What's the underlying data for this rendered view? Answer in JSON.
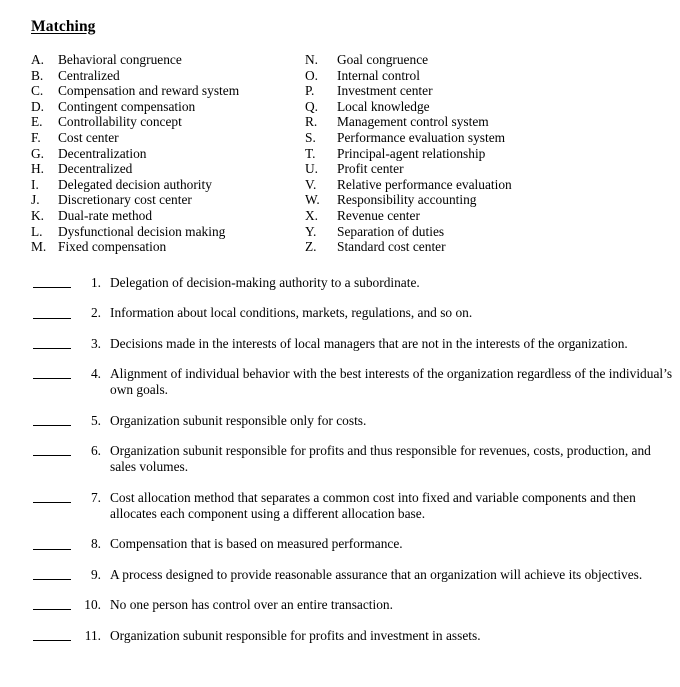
{
  "document": {
    "title": "Matching"
  },
  "terms": {
    "left_column": [
      {
        "key": "A.",
        "label": "Behavioral congruence"
      },
      {
        "key": "B.",
        "label": "Centralized"
      },
      {
        "key": "C.",
        "label": "Compensation and reward system"
      },
      {
        "key": "D.",
        "label": "Contingent compensation"
      },
      {
        "key": "E.",
        "label": "Controllability concept"
      },
      {
        "key": "F.",
        "label": "Cost center"
      },
      {
        "key": "G.",
        "label": "Decentralization"
      },
      {
        "key": "H.",
        "label": "Decentralized"
      },
      {
        "key": "I.",
        "label": "Delegated decision authority"
      },
      {
        "key": "J.",
        "label": "Discretionary cost center"
      },
      {
        "key": "K.",
        "label": "Dual-rate method"
      },
      {
        "key": "L.",
        "label": "Dysfunctional decision making"
      },
      {
        "key": "M.",
        "label": "Fixed compensation"
      }
    ],
    "right_column": [
      {
        "key": "N.",
        "label": "Goal congruence"
      },
      {
        "key": "O.",
        "label": "Internal control"
      },
      {
        "key": "P.",
        "label": "Investment center"
      },
      {
        "key": "Q.",
        "label": "Local knowledge"
      },
      {
        "key": "R.",
        "label": "Management control system"
      },
      {
        "key": "S.",
        "label": "Performance evaluation system"
      },
      {
        "key": "T.",
        "label": "Principal-agent relationship"
      },
      {
        "key": "U.",
        "label": "Profit center"
      },
      {
        "key": "V.",
        "label": "Relative performance evaluation"
      },
      {
        "key": "W.",
        "label": "Responsibility accounting"
      },
      {
        "key": "X.",
        "label": "Revenue center"
      },
      {
        "key": "Y.",
        "label": "Separation of duties"
      },
      {
        "key": "Z.",
        "label": "Standard cost center"
      }
    ]
  },
  "questions": [
    {
      "number": "1.",
      "answer": "",
      "text": "Delegation of decision-making authority to a subordinate."
    },
    {
      "number": "2.",
      "answer": "",
      "text": "Information about local conditions, markets, regulations, and so on."
    },
    {
      "number": "3.",
      "answer": "",
      "text": "Decisions made in the interests of local managers that are not in the interests of the organization."
    },
    {
      "number": "4.",
      "answer": "",
      "text": "Alignment of individual behavior with the best interests of the organization regardless of the individual’s own goals."
    },
    {
      "number": "5.",
      "answer": "",
      "text": "Organization subunit responsible only for costs."
    },
    {
      "number": "6.",
      "answer": "",
      "text": "Organization subunit responsible for profits and thus responsible for revenues, costs, production, and sales volumes."
    },
    {
      "number": "7.",
      "answer": "",
      "text": "Cost allocation method that separates a common cost into fixed and variable components and then allocates each component using a different allocation base."
    },
    {
      "number": "8.",
      "answer": "",
      "text": "Compensation that is based on measured performance."
    },
    {
      "number": "9.",
      "answer": "",
      "text": "A process designed to provide reasonable assurance that an organization will achieve its objectives."
    },
    {
      "number": "10.",
      "answer": "",
      "text": "No one person has control over an entire transaction."
    },
    {
      "number": "11.",
      "answer": "",
      "text": "Organization subunit responsible for profits and investment in assets."
    }
  ]
}
